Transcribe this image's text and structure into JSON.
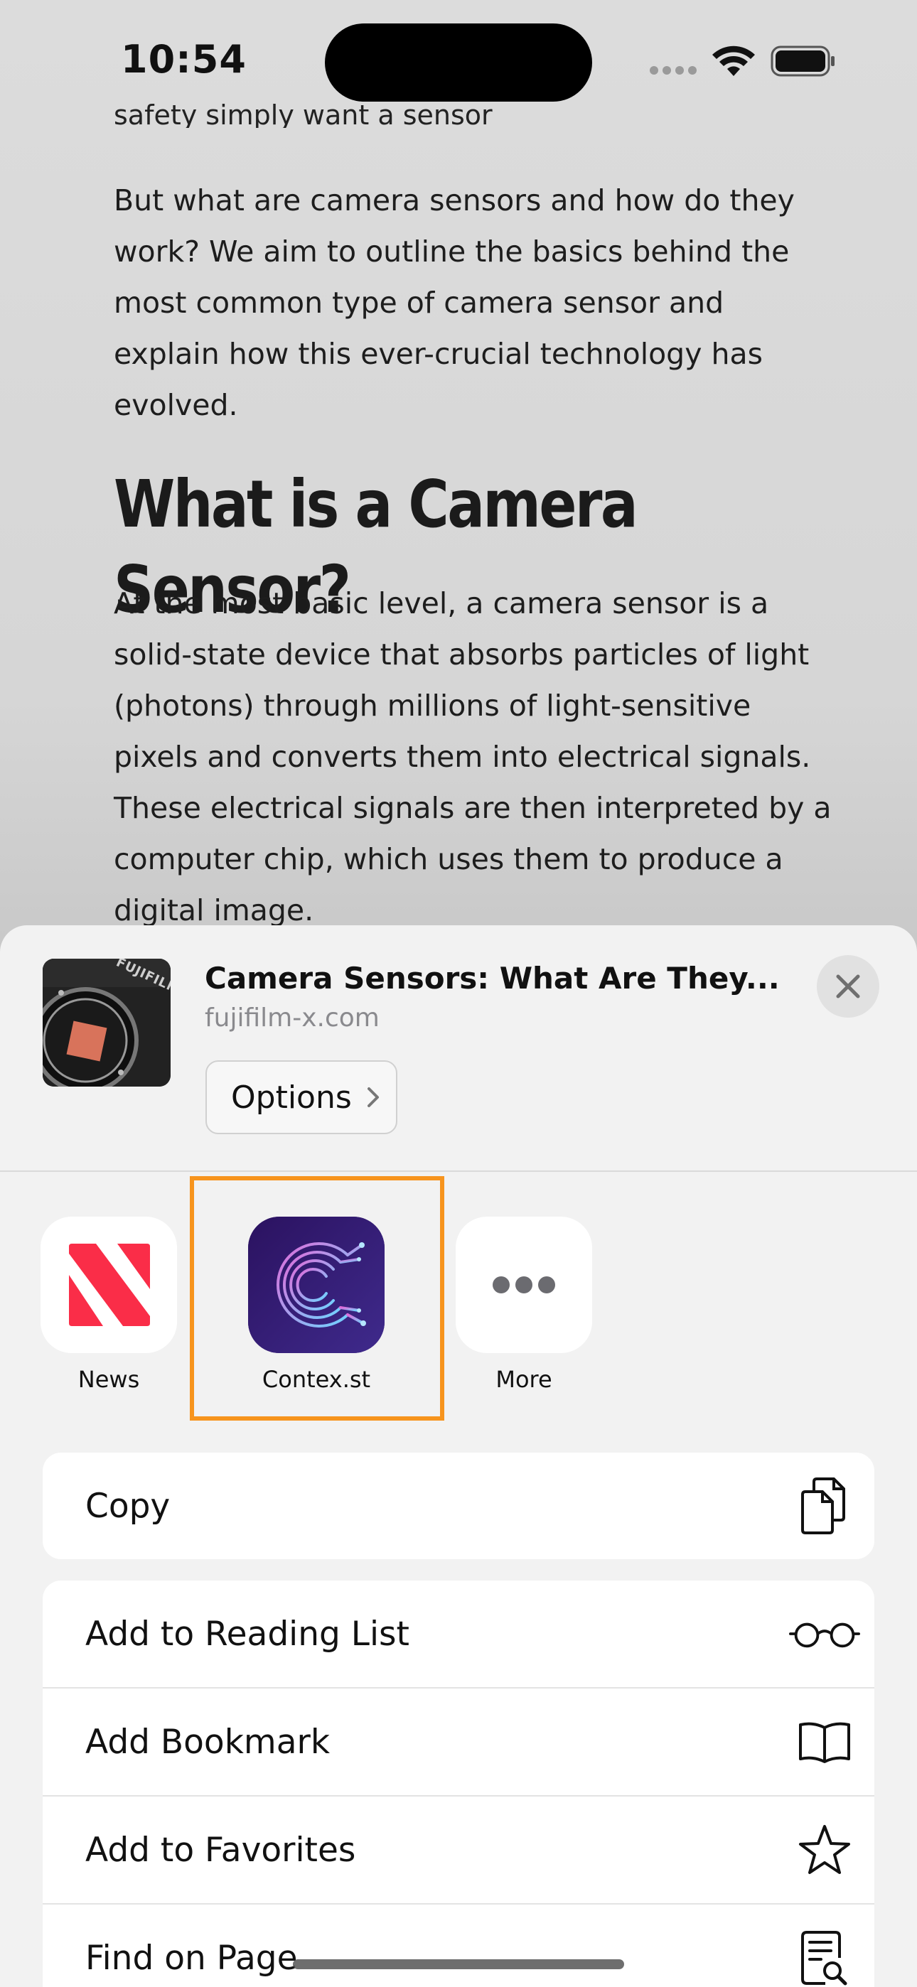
{
  "status": {
    "time": "10:54"
  },
  "article": {
    "cut_line": "safety simply want a sensor",
    "para1": "But what are camera sensors and how do they work? We aim to outline the basics behind the most common type of camera sensor and explain how this ever-crucial technology has evolved.",
    "heading": "What is a Camera Sensor?",
    "para2": "At the most basic level, a camera sensor is a solid-state device that absorbs particles of light (photons) through millions of light-sensitive pixels and converts them into electrical signals. These electrical signals are then interpreted by a computer chip, which uses them to produce a digital image."
  },
  "share": {
    "title": "Camera Sensors: What Are They...",
    "domain": "fujifilm-x.com",
    "options_label": "Options",
    "thumb_brand": "FUJIFILM",
    "apps": [
      {
        "label": "News",
        "icon": "news-icon"
      },
      {
        "label": "Contex.st",
        "icon": "contexst-icon"
      },
      {
        "label": "More",
        "icon": "more-icon"
      }
    ],
    "actions_group1": [
      {
        "label": "Copy",
        "icon": "copy-icon"
      }
    ],
    "actions_group2": [
      {
        "label": "Add to Reading List",
        "icon": "glasses-icon"
      },
      {
        "label": "Add Bookmark",
        "icon": "book-icon"
      },
      {
        "label": "Add to Favorites",
        "icon": "star-icon"
      },
      {
        "label": "Find on Page",
        "icon": "find-on-page-icon"
      }
    ],
    "highlight_color": "#f7941d"
  }
}
